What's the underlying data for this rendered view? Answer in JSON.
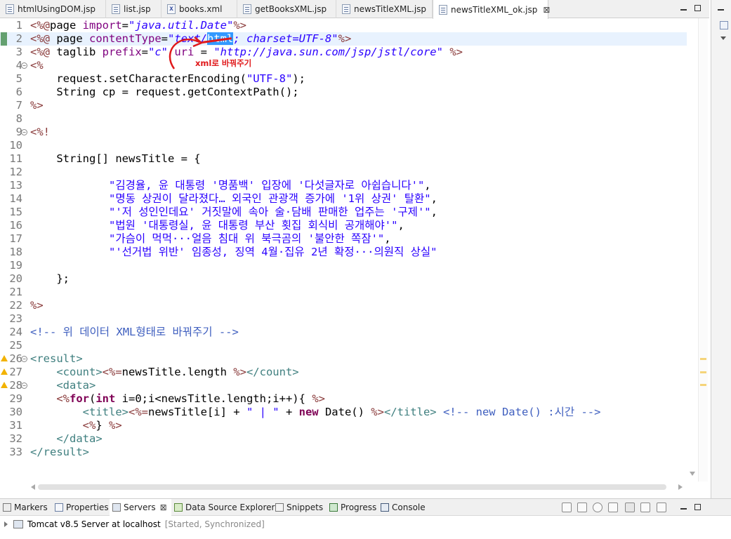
{
  "editor_tabs": [
    {
      "label": "htmlUsingDOM.jsp",
      "icon": "jsp-file-icon",
      "active": false
    },
    {
      "label": "list.jsp",
      "icon": "jsp-file-icon",
      "active": false
    },
    {
      "label": "books.xml",
      "icon": "xml-file-icon",
      "active": false
    },
    {
      "label": "getBooksXML.jsp",
      "icon": "jsp-file-icon",
      "active": false
    },
    {
      "label": "newsTitleXML.jsp",
      "icon": "jsp-file-icon",
      "active": false
    },
    {
      "label": "newsTitleXML_ok.jsp",
      "icon": "jsp-file-icon",
      "active": true
    }
  ],
  "close_glyph": "⊠",
  "code": {
    "line_numbers": [
      "1",
      "2",
      "3",
      "4",
      "5",
      "6",
      "7",
      "8",
      "9",
      "10",
      "11",
      "12",
      "13",
      "14",
      "15",
      "16",
      "17",
      "18",
      "19",
      "20",
      "21",
      "22",
      "23",
      "24",
      "25",
      "26",
      "27",
      "28",
      "29",
      "30",
      "31",
      "32",
      "33"
    ],
    "lines": [
      [
        [
          "tag",
          "<%@"
        ],
        [
          "code",
          "page "
        ],
        [
          "attr",
          "import"
        ],
        [
          "code",
          "="
        ],
        [
          "str",
          "\"java.util.Date\""
        ],
        [
          "tag",
          "%>"
        ]
      ],
      [
        [
          "tag",
          "<%@"
        ],
        [
          "code",
          " page "
        ],
        [
          "attr",
          "contentType"
        ],
        [
          "code",
          "="
        ],
        [
          "str",
          "\"text/"
        ],
        [
          "sel",
          "html"
        ],
        [
          "str",
          "; charset=UTF-8\""
        ],
        [
          "tag",
          "%>"
        ]
      ],
      [
        [
          "tag",
          "<%@"
        ],
        [
          "code",
          " taglib "
        ],
        [
          "attr",
          "prefix"
        ],
        [
          "code",
          "="
        ],
        [
          "str",
          "\"c\""
        ],
        [
          "code",
          " "
        ],
        [
          "attr",
          "uri"
        ],
        [
          "code",
          " = "
        ],
        [
          "str",
          "\"http://java.sun.com/jsp/jstl/core\""
        ],
        [
          "code",
          " "
        ],
        [
          "tag",
          "%>"
        ]
      ],
      [
        [
          "tag",
          "<%"
        ]
      ],
      [
        [
          "code",
          "    request.setCharacterEncoding("
        ],
        [
          "jstr",
          "\"UTF-8\""
        ],
        [
          "code",
          ");"
        ]
      ],
      [
        [
          "code",
          "    String cp = request.getContextPath();"
        ]
      ],
      [
        [
          "tag",
          "%>"
        ]
      ],
      [],
      [
        [
          "tag",
          "<%!"
        ]
      ],
      [],
      [
        [
          "code",
          "    String[] newsTitle = {"
        ]
      ],
      [],
      [
        [
          "code",
          "            "
        ],
        [
          "jstr",
          "\"김경율, 윤 대통령 '명품백' 입장에 '다섯글자로 아쉽습니다'\""
        ],
        [
          "code",
          ","
        ]
      ],
      [
        [
          "code",
          "            "
        ],
        [
          "jstr",
          "\"명동 상권이 달라졌다… 외국인 관광객 증가에 '1위 상권' 탈환\""
        ],
        [
          "code",
          ","
        ]
      ],
      [
        [
          "code",
          "            "
        ],
        [
          "jstr",
          "\"'저 성인인데요' 거짓말에 속아 술·담배 판매한 업주는 '구제'\""
        ],
        [
          "code",
          ","
        ]
      ],
      [
        [
          "code",
          "            "
        ],
        [
          "jstr",
          "\"법원 '대통령실, 윤 대통령 부산 횟집 회식비 공개해야'\""
        ],
        [
          "code",
          ","
        ]
      ],
      [
        [
          "code",
          "            "
        ],
        [
          "jstr",
          "\"가슴이 먹먹···얼음 침대 위 북극곰의 '불안한 쪽잠'\""
        ],
        [
          "code",
          ","
        ]
      ],
      [
        [
          "code",
          "            "
        ],
        [
          "jstr",
          "\"'선거법 위반' 임종성, 징역 4월·집유 2년 확정···의원직 상실\""
        ]
      ],
      [],
      [
        [
          "code",
          "    };"
        ]
      ],
      [],
      [
        [
          "tag",
          "%>"
        ]
      ],
      [],
      [
        [
          "cmt",
          "<!-- 위 데이터 XML형태로 바꿔주기 -->"
        ]
      ],
      [],
      [
        [
          "xml",
          "<result>"
        ]
      ],
      [
        [
          "code",
          "    "
        ],
        [
          "xml",
          "<count>"
        ],
        [
          "tag",
          "<%="
        ],
        [
          "code",
          "newsTitle.length "
        ],
        [
          "tag",
          "%>"
        ],
        [
          "xml",
          "</count>"
        ]
      ],
      [
        [
          "code",
          "    "
        ],
        [
          "xml",
          "<data>"
        ]
      ],
      [
        [
          "code",
          "    "
        ],
        [
          "tag",
          "<%"
        ],
        [
          "kw",
          "for"
        ],
        [
          "code",
          "("
        ],
        [
          "kw",
          "int"
        ],
        [
          "code",
          " i=0;i<newsTitle.length;i++){ "
        ],
        [
          "tag",
          "%>"
        ]
      ],
      [
        [
          "code",
          "        "
        ],
        [
          "xml",
          "<title>"
        ],
        [
          "tag",
          "<%="
        ],
        [
          "code",
          "newsTitle[i] + "
        ],
        [
          "jstr",
          "\" | \""
        ],
        [
          "code",
          " + "
        ],
        [
          "kw",
          "new"
        ],
        [
          "code",
          " Date() "
        ],
        [
          "tag",
          "%>"
        ],
        [
          "xml",
          "</title>"
        ],
        [
          "code",
          " "
        ],
        [
          "cmt",
          "<!-- new Date() :시간 -->"
        ]
      ],
      [
        [
          "code",
          "        "
        ],
        [
          "tag",
          "<%"
        ],
        [
          "code",
          "} "
        ],
        [
          "tag",
          "%>"
        ]
      ],
      [
        [
          "code",
          "    "
        ],
        [
          "xml",
          "</data>"
        ]
      ],
      [
        [
          "xml",
          "</result>"
        ]
      ]
    ],
    "current_line": 2,
    "warning_lines": [
      26,
      27,
      28
    ],
    "fold_lines": [
      4,
      9,
      26,
      28
    ],
    "annotation": "xml로 바꿔주기"
  },
  "bottom_tabs": [
    {
      "label": "Markers",
      "icon": "markers-icon",
      "active": false
    },
    {
      "label": "Properties",
      "icon": "properties-icon",
      "active": false
    },
    {
      "label": "Servers",
      "icon": "servers-icon",
      "active": true
    },
    {
      "label": "Data Source Explorer",
      "icon": "data-source-icon",
      "active": false
    },
    {
      "label": "Snippets",
      "icon": "snippets-icon",
      "active": false
    },
    {
      "label": "Progress",
      "icon": "progress-icon",
      "active": false
    },
    {
      "label": "Console",
      "icon": "console-icon",
      "active": false
    }
  ],
  "server": {
    "name": "Tomcat v8.5 Server at localhost",
    "state": "[Started, Synchronized]"
  },
  "colors": {
    "tag": "#8a3b3b",
    "attr": "#7f007f",
    "string": "#2a00ff",
    "keyword": "#7f0055",
    "xml_tag": "#3f7f7f",
    "comment": "#3f5fbf",
    "annotation": "#e0191b",
    "selection": "#3399ff"
  }
}
